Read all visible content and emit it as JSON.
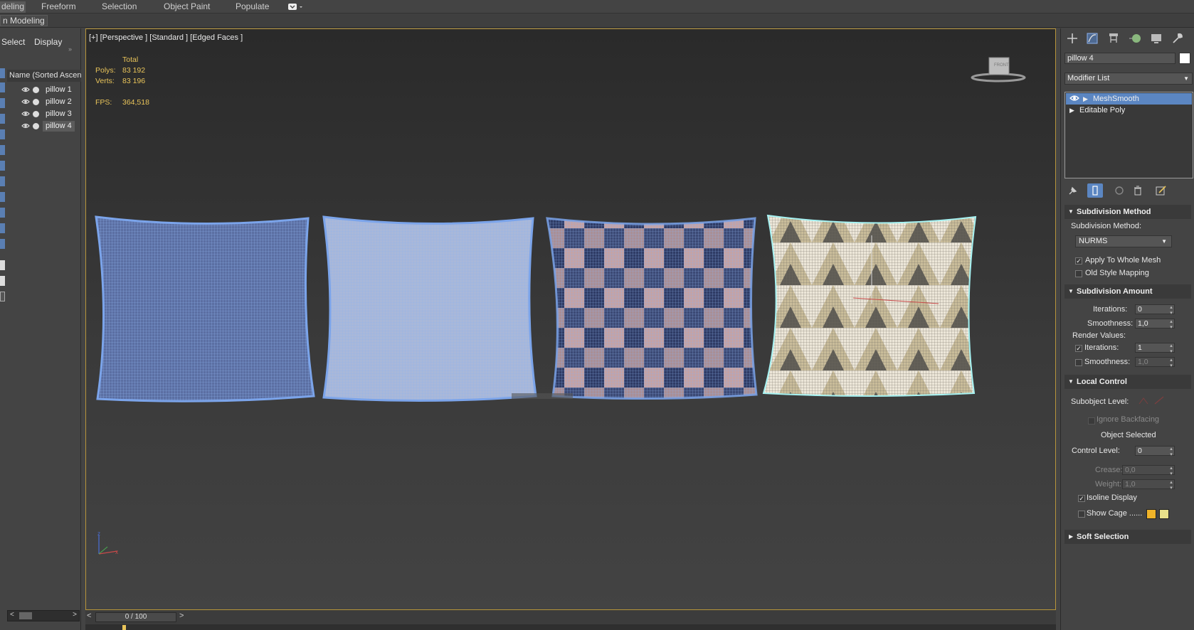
{
  "ribbon": {
    "tabs": [
      "deling",
      "Freeform",
      "Selection",
      "Object Paint",
      "Populate"
    ],
    "sub_label": "n Modeling"
  },
  "explorer": {
    "menu_select": "Select",
    "menu_display": "Display",
    "header": "Name (Sorted Ascending)",
    "items": [
      {
        "label": "pillow 1",
        "selected": false
      },
      {
        "label": "pillow 2",
        "selected": false
      },
      {
        "label": "pillow 3",
        "selected": false
      },
      {
        "label": "pillow 4",
        "selected": true
      }
    ]
  },
  "viewport": {
    "label": "[+] [Perspective ] [Standard ] [Edged Faces ]",
    "stats": {
      "total_label": "Total",
      "polys_label": "Polys:",
      "polys_value": "83 192",
      "verts_label": "Verts:",
      "verts_value": "83 196",
      "fps_label": "FPS:",
      "fps_value": "364,518"
    },
    "viewcube_label": "FRONT"
  },
  "timeline": {
    "value": "0 / 100",
    "prev": "<",
    "next": ">"
  },
  "command_panel": {
    "object_name": "pillow 4",
    "modifier_list": "Modifier List",
    "stack": [
      "MeshSmooth",
      "Editable Poly"
    ],
    "subdivision_method": {
      "title": "Subdivision Method",
      "method_label": "Subdivision Method:",
      "method_value": "NURMS",
      "apply_whole": "Apply To Whole Mesh",
      "old_style": "Old Style Mapping"
    },
    "subdivision_amount": {
      "title": "Subdivision Amount",
      "iterations_label": "Iterations:",
      "iterations_value": "0",
      "smoothness_label": "Smoothness:",
      "smoothness_value": "1,0",
      "render_values": "Render Values:",
      "r_iterations_label": "Iterations:",
      "r_iterations_value": "1",
      "r_smoothness_label": "Smoothness:",
      "r_smoothness_value": "1,0"
    },
    "local_control": {
      "title": "Local Control",
      "subobject_level": "Subobject Level:",
      "ignore_backfacing": "Ignore Backfacing",
      "object_selected": "Object Selected",
      "control_level_label": "Control Level:",
      "control_level_value": "0",
      "crease_label": "Crease:",
      "crease_value": "0,0",
      "weight_label": "Weight:",
      "weight_value": "1,0",
      "isoline": "Isoline Display",
      "show_cage": "Show Cage ......"
    },
    "soft_selection": {
      "title": "Soft Selection"
    }
  },
  "colors": {
    "accent": "#5b86c2",
    "viewport_border": "#b8953a",
    "stats_text": "#e9c45a",
    "cage_color_1": "#f0b429",
    "cage_color_2": "#e8e08a"
  }
}
